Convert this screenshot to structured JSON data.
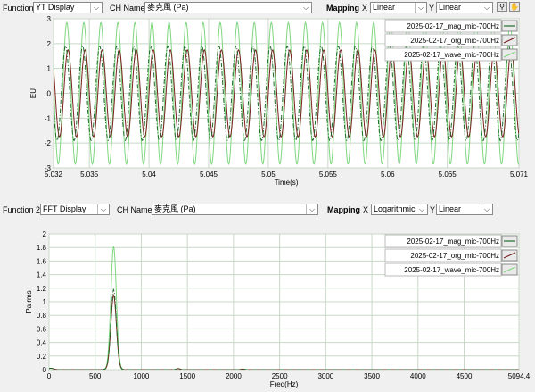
{
  "top": {
    "function_label": "Function",
    "function_value": "YT Display",
    "ch_label": "CH Name",
    "ch_value": "麥克風 (Pa)",
    "mapping_label": "Mapping",
    "x_label": "X",
    "x_value": "Linear",
    "y_label": "Y",
    "y_value": "Linear"
  },
  "bottom": {
    "function_label": "Function 2",
    "function_value": "FFT Display",
    "ch_label": "CH Name",
    "ch_value": "麥克風 (Pa)",
    "mapping_label": "Mapping",
    "x_label": "X",
    "x_value": "Logarithmic",
    "y_label": "Y",
    "y_value": "Linear"
  },
  "chart_data": [
    {
      "type": "line",
      "xlabel": "Time(s)",
      "ylabel": "EU",
      "xlim": [
        5.032,
        5.071
      ],
      "ylim": [
        -3,
        3
      ],
      "x_ticks": [
        "5.032",
        "5.035",
        "5.04",
        "5.045",
        "5.05",
        "5.055",
        "5.06",
        "5.065",
        "5.071"
      ],
      "y_ticks": [
        "3",
        "2",
        "1",
        "0",
        "-1",
        "-2",
        "-3"
      ],
      "grid": true,
      "legend_position": "top-right",
      "signal_frequency_hz": 700,
      "series": [
        {
          "name": "2025-02-17_mag_mic-700Hz",
          "color": "#1e6b2a",
          "amplitude": 1.9,
          "phase": 0.9,
          "style": "dash-dot"
        },
        {
          "name": "2025-02-17_org_mic-700Hz",
          "color": "#7a2020",
          "amplitude": 1.75,
          "phase": 0.0,
          "style": "solid"
        },
        {
          "name": "2025-02-17_wave_mic-700Hz",
          "color": "#7fd67f",
          "amplitude": 2.85,
          "phase": 0.45,
          "style": "solid"
        }
      ]
    },
    {
      "type": "line",
      "xlabel": "Freq(Hz)",
      "ylabel": "Pa rms",
      "xlim": [
        0,
        5094.4
      ],
      "ylim": [
        0,
        2
      ],
      "x_ticks": [
        "0",
        "500",
        "1000",
        "1500",
        "2000",
        "2500",
        "3000",
        "3500",
        "4000",
        "4500",
        "5094.4"
      ],
      "y_ticks": [
        "2",
        "1.8",
        "1.6",
        "1.4",
        "1.2",
        "1",
        "0.8",
        "0.6",
        "0.4",
        "0.2",
        "0"
      ],
      "grid": true,
      "legend_position": "top-right",
      "series": [
        {
          "name": "2025-02-17_mag_mic-700Hz",
          "color": "#1e6b2a",
          "peak_x": 700,
          "peak_y": 1.18,
          "style": "dash-dot"
        },
        {
          "name": "2025-02-17_org_mic-700Hz",
          "color": "#7a2020",
          "peak_x": 700,
          "peak_y": 1.1,
          "style": "solid"
        },
        {
          "name": "2025-02-17_wave_mic-700Hz",
          "color": "#7fd67f",
          "peak_x": 700,
          "peak_y": 1.82,
          "style": "solid"
        }
      ]
    }
  ]
}
